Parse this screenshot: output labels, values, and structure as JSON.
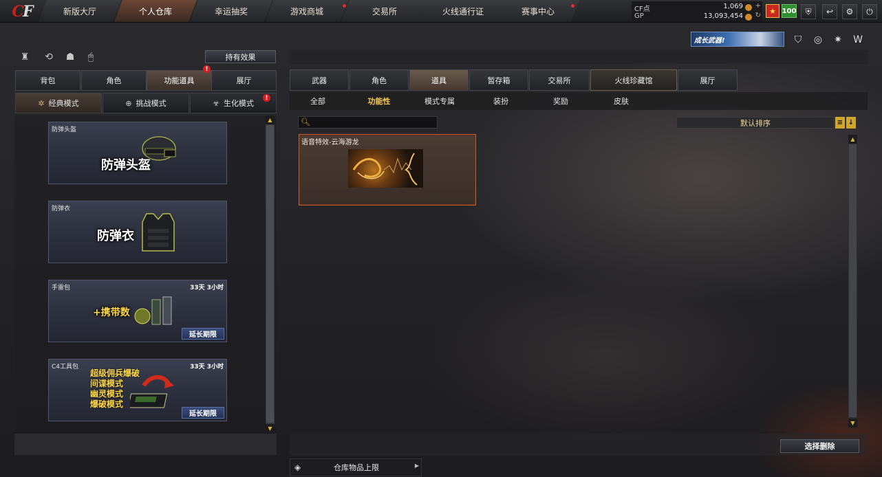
{
  "logo": {
    "text_c": "C",
    "text_f": "F"
  },
  "nav": {
    "tabs": [
      {
        "label": "新版大厅"
      },
      {
        "label": "个人仓库"
      },
      {
        "label": "幸运抽奖"
      },
      {
        "label": "游戏商城"
      },
      {
        "label": "交易所"
      },
      {
        "label": "火线通行证"
      },
      {
        "label": "赛事中心"
      }
    ]
  },
  "currency": {
    "cf_label": "CF点",
    "cf_value": "1,069",
    "gp_label": "GP",
    "gp_value": "13,093,454"
  },
  "status": {
    "rank_badge": "★",
    "level_badge": "100"
  },
  "left": {
    "hold_effect_label": "持有效果",
    "tabs": [
      {
        "label": "背包"
      },
      {
        "label": "角色"
      },
      {
        "label": "功能道具"
      },
      {
        "label": "展厅"
      }
    ],
    "modes": [
      {
        "label": "经典模式",
        "icon": "✲"
      },
      {
        "label": "挑战模式",
        "icon": "⊕"
      },
      {
        "label": "生化模式",
        "icon": "☣"
      }
    ],
    "badge": "!",
    "items": [
      {
        "title": "防弹头盔",
        "main": "防弹头盔",
        "time": "",
        "extend": ""
      },
      {
        "title": "防弹衣",
        "main": "防弹衣",
        "time": "",
        "extend": ""
      },
      {
        "title": "手雷包",
        "main": "+携带数",
        "time": "33天 3小时",
        "extend": "延长期限"
      },
      {
        "title": "C4工具包",
        "main": "",
        "time": "33天 3小时",
        "extend": "延长期限",
        "sub_lines": [
          "超级佣兵爆破",
          "间谍模式",
          "幽灵模式",
          "爆破模式"
        ]
      }
    ]
  },
  "right": {
    "banner": "成长武器!",
    "tabs": [
      {
        "label": "武器"
      },
      {
        "label": "角色"
      },
      {
        "label": "道具"
      },
      {
        "label": "暂存箱"
      },
      {
        "label": "交易所"
      },
      {
        "label": "火线珍藏馆"
      },
      {
        "label": "展厅"
      }
    ],
    "subtabs": [
      {
        "label": "全部"
      },
      {
        "label": "功能性"
      },
      {
        "label": "模式专属"
      },
      {
        "label": "装扮"
      },
      {
        "label": "奖励"
      },
      {
        "label": "皮肤"
      }
    ],
    "search_placeholder": "",
    "sort_label": "默认排序",
    "items": [
      {
        "title": "语音特效-云海游龙"
      }
    ],
    "delete_label": "选择删除",
    "capacity_label": "仓库物品上限"
  }
}
